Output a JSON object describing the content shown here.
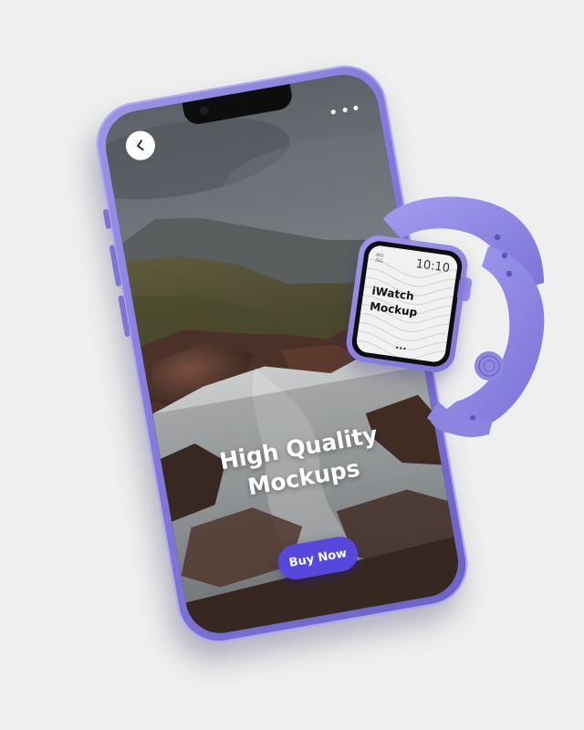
{
  "phone": {
    "back_icon": "chevron-left-icon",
    "more_icon": "more-horizontal-icon",
    "headline_line1": "High Quality",
    "headline_line2": "Mockups",
    "cta_label": "Buy Now"
  },
  "watch": {
    "mini_line1": "MO",
    "mini_line2": "ISG",
    "time": "10:10",
    "title_line1": "iWatch",
    "title_line2": "Mockup",
    "dots": "..."
  },
  "colors": {
    "background": "#efefef",
    "device_purple": "#8178d8",
    "cta_button": "#5648dc",
    "headline_text": "#ffffff"
  }
}
